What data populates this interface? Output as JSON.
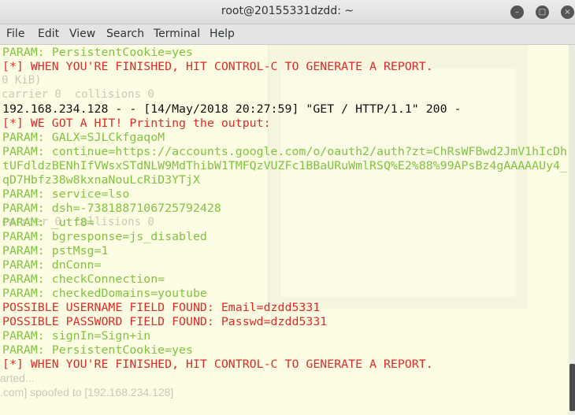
{
  "window": {
    "title": "root@20155331dzdd: ~",
    "controls": [
      "minimize",
      "maximize",
      "close"
    ]
  },
  "menu": [
    "File",
    "Edit",
    "View",
    "Search",
    "Terminal",
    "Help"
  ],
  "lines": [
    {
      "t": "PARAM: PersistentCookie=yes",
      "c": "g"
    },
    {
      "t": "[*] WHEN YOU'RE FINISHED, HIT CONTROL-C TO GENERATE A REPORT.",
      "c": "r"
    },
    {
      "t": "",
      "c": "g"
    },
    {
      "t": "",
      "c": "g"
    },
    {
      "t": "192.168.234.128 - - [14/May/2018 20:27:59] \"GET / HTTP/1.1\" 200 -",
      "c": "k"
    },
    {
      "t": "[*] WE GOT A HIT! Printing the output:",
      "c": "r"
    },
    {
      "t": "PARAM: GALX=SJLCkfgaqoM",
      "c": "g"
    },
    {
      "t": "PARAM: continue=https://accounts.google.com/o/oauth2/auth?zt=ChRsWFBwd2JmV1hIcDh",
      "c": "g"
    },
    {
      "t": "tUFdldzBENhIfVWsxSTdNLW9MdThibW1TMFQzVUZFc1BBaURuWmlRSQ%E2%88%99APsBz4gAAAAAUy4_",
      "c": "g"
    },
    {
      "t": "qD7Hbfz38w8kxnaNouLcRiD3YTjX",
      "c": "g"
    },
    {
      "t": "PARAM: service=lso",
      "c": "g"
    },
    {
      "t": "PARAM: dsh=-7381887106725792428",
      "c": "g"
    },
    {
      "t": "PARAM: _utf8=",
      "c": "g"
    },
    {
      "t": "PARAM: bgresponse=js_disabled",
      "c": "g"
    },
    {
      "t": "PARAM: pstMsg=1",
      "c": "g"
    },
    {
      "t": "PARAM: dnConn=",
      "c": "g"
    },
    {
      "t": "PARAM: checkConnection=",
      "c": "g"
    },
    {
      "t": "PARAM: checkedDomains=youtube",
      "c": "g"
    },
    {
      "t": "POSSIBLE USERNAME FIELD FOUND: Email=dzdd5331",
      "c": "r"
    },
    {
      "t": "POSSIBLE PASSWORD FIELD FOUND: Passwd=dzdd5331",
      "c": "r"
    },
    {
      "t": "PARAM: signIn=Sign+in",
      "c": "g"
    },
    {
      "t": "PARAM: PersistentCookie=yes",
      "c": "g"
    },
    {
      "t": "[*] WHEN YOU'RE FINISHED, HIT CONTROL-C TO GENERATE A REPORT.",
      "c": "r"
    }
  ],
  "background_ghost": {
    "mono": [
      {
        "t": "0 KiB)",
        "row": 2
      },
      {
        "t": "carrier 0  collisions 0",
        "row": 3
      },
      {
        "t": "carrier 0  collisions 0",
        "row": 12
      }
    ],
    "sans": [
      {
        "t": "arted...",
        "row": 23
      },
      {
        "t": ".com] spoofed to [192.168.234.128]",
        "row": 24
      }
    ]
  },
  "colors": {
    "param": "#80c341",
    "alert": "#df2a2a",
    "normal": "#111111",
    "background": "#fcfde2"
  }
}
